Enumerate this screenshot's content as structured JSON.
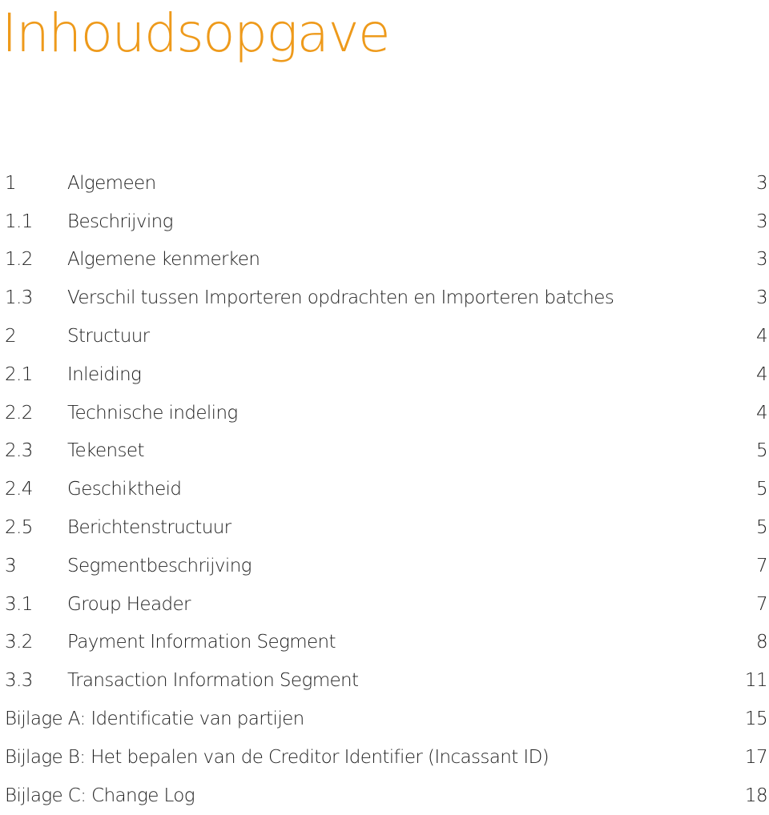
{
  "title": "Inhoudsopgave",
  "colors": {
    "title": "#ee9a1b",
    "text": "#1e1e1e"
  },
  "toc": [
    {
      "number": "1",
      "label": "Algemeen",
      "page": "3"
    },
    {
      "number": "1.1",
      "label": "Beschrijving",
      "page": "3"
    },
    {
      "number": "1.2",
      "label": "Algemene kenmerken",
      "page": "3"
    },
    {
      "number": "1.3",
      "label": "Verschil tussen Importeren opdrachten en Importeren batches",
      "page": "3"
    },
    {
      "number": "2",
      "label": "Structuur",
      "page": "4"
    },
    {
      "number": "2.1",
      "label": "Inleiding",
      "page": "4"
    },
    {
      "number": "2.2",
      "label": "Technische indeling",
      "page": "4"
    },
    {
      "number": "2.3",
      "label": "Tekenset",
      "page": "5"
    },
    {
      "number": "2.4",
      "label": "Geschiktheid",
      "page": "5"
    },
    {
      "number": "2.5",
      "label": "Berichtenstructuur",
      "page": "5"
    },
    {
      "number": "3",
      "label": "Segmentbeschrijving",
      "page": "7"
    },
    {
      "number": "3.1",
      "label": "Group Header",
      "page": "7"
    },
    {
      "number": "3.2",
      "label": "Payment Information Segment",
      "page": "8"
    },
    {
      "number": "3.3",
      "label": "Transaction Information Segment",
      "page": "11"
    },
    {
      "number": "",
      "label": "Bijlage A: Identificatie van partijen",
      "page": "15"
    },
    {
      "number": "",
      "label": "Bijlage B: Het bepalen van de Creditor Identifier (Incassant ID)",
      "page": "17"
    },
    {
      "number": "",
      "label": "Bijlage C: Change Log",
      "page": "18"
    }
  ]
}
